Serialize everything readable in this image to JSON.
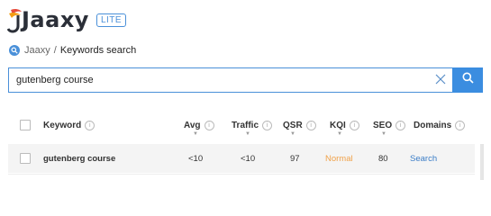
{
  "brand": {
    "name": "Jaaxy",
    "badge": "LITE"
  },
  "breadcrumb": {
    "root": "Jaaxy",
    "separator": "/",
    "current": "Keywords search"
  },
  "search": {
    "value": "gutenberg course",
    "placeholder": ""
  },
  "table": {
    "headers": {
      "keyword": "Keyword",
      "avg": "Avg",
      "traffic": "Traffic",
      "qsr": "QSR",
      "kqi": "KQI",
      "seo": "SEO",
      "domains": "Domains"
    },
    "rows": [
      {
        "keyword": "gutenberg course",
        "avg": "<10",
        "traffic": "<10",
        "qsr": "97",
        "kqi": "Normal",
        "seo": "80",
        "domains": "Search"
      }
    ]
  },
  "colors": {
    "accent": "#3b8de0",
    "kqi_normal": "#f0a24a",
    "link": "#3b7dc7"
  }
}
